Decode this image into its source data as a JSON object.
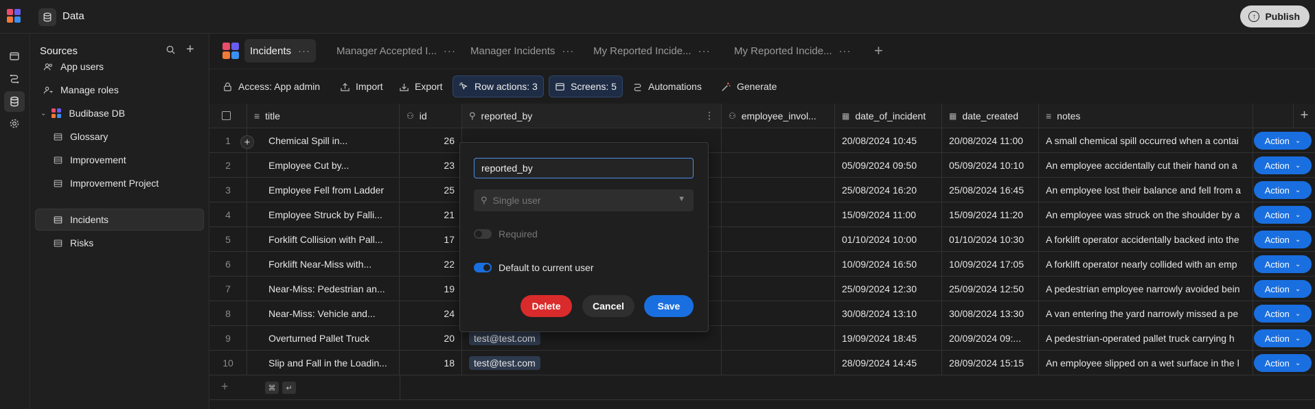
{
  "app": {
    "title": "Data"
  },
  "publish": {
    "label": "Publish"
  },
  "sources": {
    "title": "Sources",
    "items": [
      {
        "label": "App users"
      },
      {
        "label": "Manage roles"
      },
      {
        "label": "Budibase DB"
      },
      {
        "label": "Glossary"
      },
      {
        "label": "Improvement"
      },
      {
        "label": "Improvement Project"
      },
      {
        "label": "Incidents"
      },
      {
        "label": "Risks"
      }
    ]
  },
  "tabs": [
    {
      "label": "Incidents"
    },
    {
      "label": "Manager Accepted I..."
    },
    {
      "label": "Manager Incidents"
    },
    {
      "label": "My Reported Incide..."
    },
    {
      "label": "My Reported Incide..."
    }
  ],
  "toolbar": {
    "access": "Access: App admin",
    "import": "Import",
    "export": "Export",
    "row_actions": "Row actions: 3",
    "screens": "Screens: 5",
    "automations": "Automations",
    "generate": "Generate"
  },
  "columns": {
    "title": "title",
    "id": "id",
    "reported_by": "reported_by",
    "employee_involved": "employee_invol...",
    "date_of_incident": "date_of_incident",
    "date_created": "date_created",
    "notes": "notes"
  },
  "rows": [
    {
      "n": "1",
      "title": "Chemical Spill in...",
      "id": "26",
      "reported_by": "",
      "doi": "20/08/2024 10:45",
      "created": "20/08/2024 11:00",
      "notes": "A small chemical spill occurred when a contai",
      "action": "Action"
    },
    {
      "n": "2",
      "title": "Employee Cut by...",
      "id": "23",
      "reported_by": "",
      "doi": "05/09/2024 09:50",
      "created": "05/09/2024 10:10",
      "notes": "An employee accidentally cut their hand on a",
      "action": "Action"
    },
    {
      "n": "3",
      "title": "Employee Fell from Ladder",
      "id": "25",
      "reported_by": "",
      "doi": "25/08/2024 16:20",
      "created": "25/08/2024 16:45",
      "notes": "An employee lost their balance and fell from a",
      "action": "Action"
    },
    {
      "n": "4",
      "title": "Employee Struck by Falli...",
      "id": "21",
      "reported_by": "",
      "doi": "15/09/2024 11:00",
      "created": "15/09/2024 11:20",
      "notes": "An employee was struck on the shoulder by a",
      "action": "Action"
    },
    {
      "n": "5",
      "title": "Forklift Collision with Pall...",
      "id": "17",
      "reported_by": "",
      "doi": "01/10/2024 10:00",
      "created": "01/10/2024 10:30",
      "notes": "A forklift operator accidentally backed into the",
      "action": "Action"
    },
    {
      "n": "6",
      "title": "Forklift Near-Miss with...",
      "id": "22",
      "reported_by": "",
      "doi": "10/09/2024 16:50",
      "created": "10/09/2024 17:05",
      "notes": "A forklift operator nearly collided with an emp",
      "action": "Action"
    },
    {
      "n": "7",
      "title": "Near-Miss: Pedestrian an...",
      "id": "19",
      "reported_by": "",
      "doi": "25/09/2024 12:30",
      "created": "25/09/2024 12:50",
      "notes": "A pedestrian employee narrowly avoided bein",
      "action": "Action"
    },
    {
      "n": "8",
      "title": "Near-Miss: Vehicle and...",
      "id": "24",
      "reported_by": "",
      "doi": "30/08/2024 13:10",
      "created": "30/08/2024 13:30",
      "notes": "A van entering the yard narrowly missed a pe",
      "action": "Action"
    },
    {
      "n": "9",
      "title": "Overturned Pallet Truck",
      "id": "20",
      "reported_by": "test@test.com",
      "doi": "19/09/2024 18:45",
      "created": "20/09/2024 09:...",
      "notes": "A pedestrian-operated pallet truck carrying h",
      "action": "Action"
    },
    {
      "n": "10",
      "title": "Slip and Fall in the Loadin...",
      "id": "18",
      "reported_by": "test@test.com",
      "doi": "28/09/2024 14:45",
      "created": "28/09/2024 15:15",
      "notes": "An employee slipped on a wet surface in the l",
      "action": "Action"
    }
  ],
  "footer": {
    "cmd": "⌘",
    "enter": "↵"
  },
  "popover": {
    "name_value": "reported_by",
    "type_placeholder": "Single user",
    "required_label": "Required",
    "required_on": false,
    "default_label": "Default to current user",
    "default_on": true,
    "delete_label": "Delete",
    "cancel_label": "Cancel",
    "save_label": "Save"
  },
  "colors": {
    "accent": "#1a6fe0",
    "danger": "#d92b2b",
    "highlight_bg": "#1e2d45"
  }
}
